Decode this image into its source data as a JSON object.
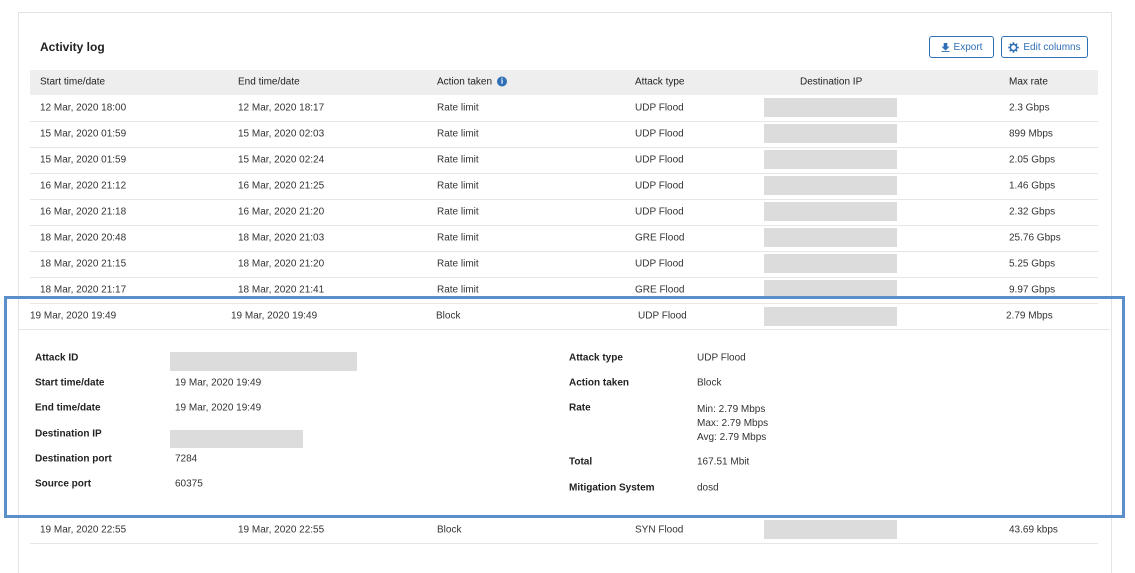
{
  "panel": {
    "title": "Activity log",
    "export_label": "Export",
    "edit_columns_label": "Edit columns",
    "accent_color": "#2f6fb5",
    "highlight_color": "#5b8fc9"
  },
  "table": {
    "columns": [
      "Start time/date",
      "End time/date",
      "Action taken",
      "Attack type",
      "Destination IP",
      "Max rate"
    ],
    "rows": [
      {
        "start": "12 Mar, 2020 18:00",
        "end": "12 Mar, 2020 18:17",
        "action": "Rate limit",
        "type": "UDP Flood",
        "rate": "2.3 Gbps"
      },
      {
        "start": "15 Mar, 2020 01:59",
        "end": "15 Mar, 2020 02:03",
        "action": "Rate limit",
        "type": "UDP Flood",
        "rate": "899 Mbps"
      },
      {
        "start": "15 Mar, 2020 01:59",
        "end": "15 Mar, 2020 02:24",
        "action": "Rate limit",
        "type": "UDP Flood",
        "rate": "2.05 Gbps"
      },
      {
        "start": "16 Mar, 2020 21:12",
        "end": "16 Mar, 2020 21:25",
        "action": "Rate limit",
        "type": "UDP Flood",
        "rate": "1.46 Gbps"
      },
      {
        "start": "16 Mar, 2020 21:18",
        "end": "16 Mar, 2020 21:20",
        "action": "Rate limit",
        "type": "UDP Flood",
        "rate": "2.32 Gbps"
      },
      {
        "start": "18 Mar, 2020 20:48",
        "end": "18 Mar, 2020 21:03",
        "action": "Rate limit",
        "type": "GRE Flood",
        "rate": "25.76 Gbps"
      },
      {
        "start": "18 Mar, 2020 21:15",
        "end": "18 Mar, 2020 21:20",
        "action": "Rate limit",
        "type": "UDP Flood",
        "rate": "5.25 Gbps"
      },
      {
        "start": "18 Mar, 2020 21:17",
        "end": "18 Mar, 2020 21:41",
        "action": "Rate limit",
        "type": "GRE Flood",
        "rate": "9.97 Gbps"
      }
    ],
    "expanded_row": {
      "start": "19 Mar, 2020 19:49",
      "end": "19 Mar, 2020 19:49",
      "action": "Block",
      "type": "UDP Flood",
      "rate": "2.79 Mbps"
    },
    "after_row": {
      "start": "19 Mar, 2020 22:55",
      "end": "19 Mar, 2020 22:55",
      "action": "Block",
      "type": "SYN Flood",
      "rate": "43.69 kbps"
    }
  },
  "details": {
    "attack_id_label": "Attack ID",
    "start_label": "Start time/date",
    "start_value": "19 Mar, 2020 19:49",
    "end_label": "End time/date",
    "end_value": "19 Mar, 2020 19:49",
    "dest_ip_label": "Destination IP",
    "dest_port_label": "Destination port",
    "dest_port_value": "7284",
    "source_port_label": "Source port",
    "source_port_value": "60375",
    "attack_type_label": "Attack type",
    "attack_type_value": "UDP Flood",
    "action_label": "Action taken",
    "action_value": "Block",
    "rate_label": "Rate",
    "rate_min": "Min: 2.79 Mbps",
    "rate_max": "Max: 2.79 Mbps",
    "rate_avg": "Avg: 2.79 Mbps",
    "total_label": "Total",
    "total_value": "167.51 Mbit",
    "mitigation_label": "Mitigation System",
    "mitigation_value": "dosd"
  }
}
